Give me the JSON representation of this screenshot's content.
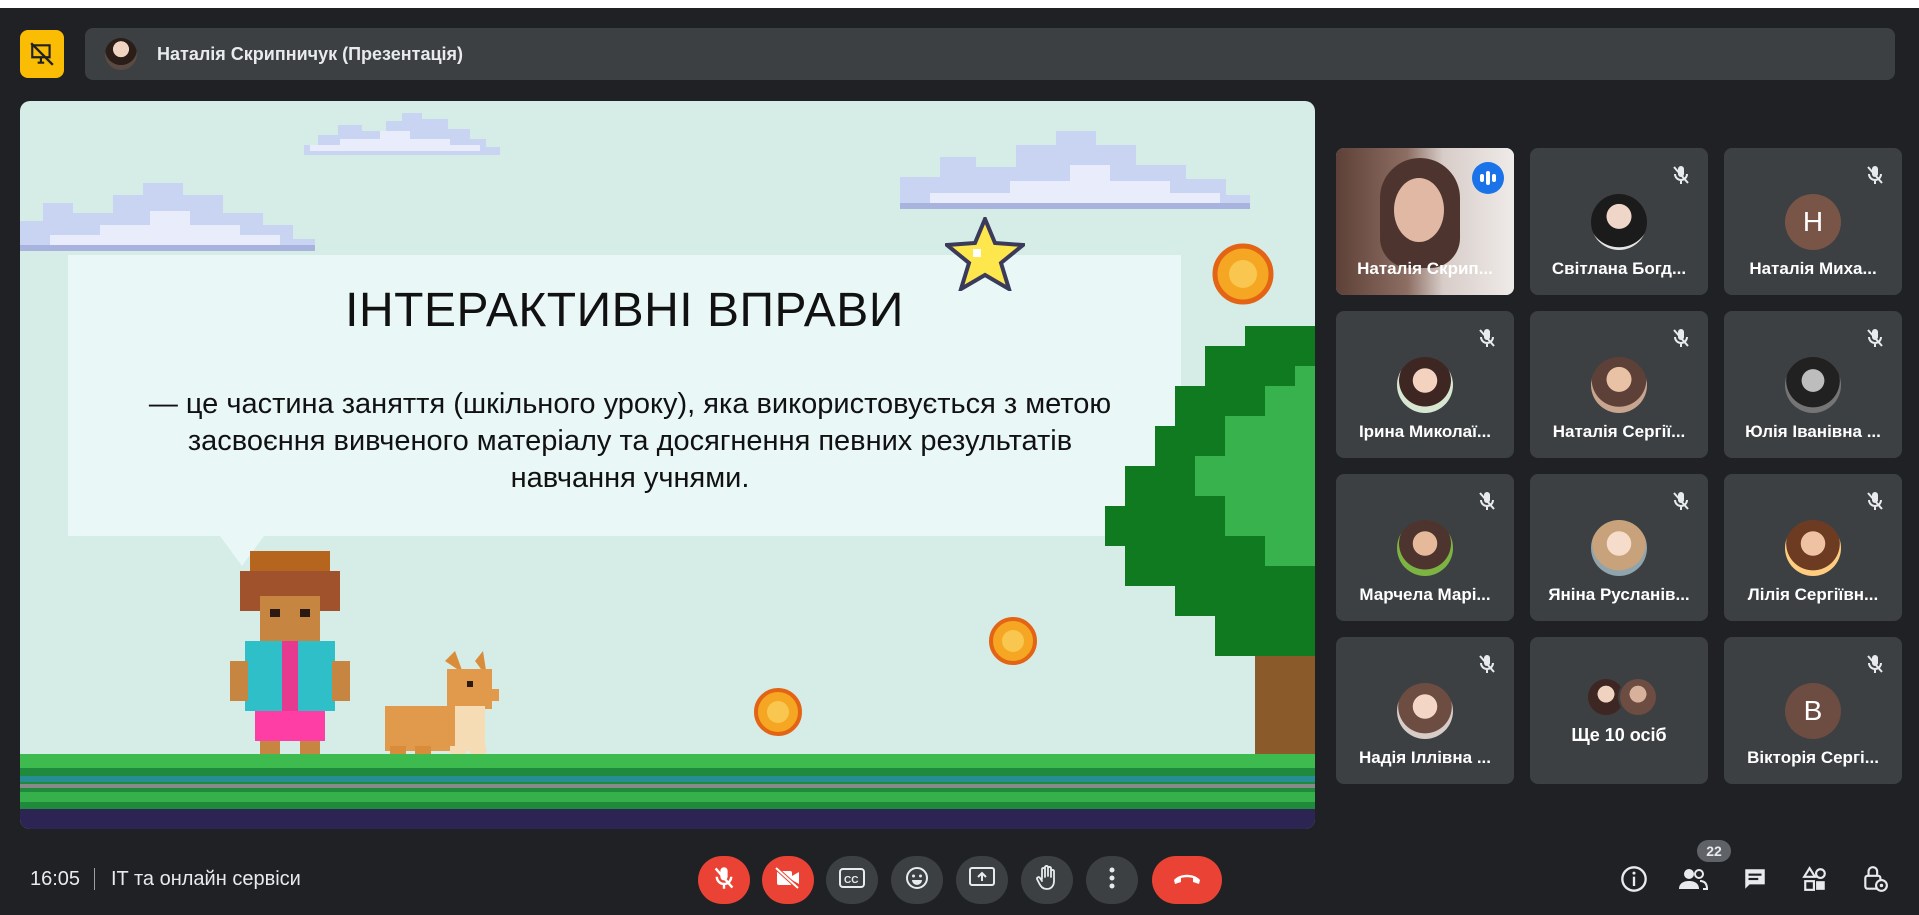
{
  "presenter": {
    "name": "Наталія Скрипничук (Презентація)"
  },
  "slide": {
    "title": "ІНТЕРАКТИВНІ ВПРАВИ",
    "text": "— це частина заняття (шкільного уроку), яка використовується з метою засвоєння вивченого матеріалу та досягнення певних результатів навчання учнями."
  },
  "participants": [
    {
      "name": "Наталія Скрип...",
      "state": "speaking"
    },
    {
      "name": "Світлана Богд...",
      "state": "muted"
    },
    {
      "name": "Наталія Миха...",
      "state": "muted",
      "initial": "Н"
    },
    {
      "name": "Ірина Миколаї...",
      "state": "muted"
    },
    {
      "name": "Наталія Сергії...",
      "state": "muted"
    },
    {
      "name": "Юлія Іванівна ...",
      "state": "muted"
    },
    {
      "name": "Марчела Марі...",
      "state": "muted"
    },
    {
      "name": "Яніна Русланів...",
      "state": "muted"
    },
    {
      "name": "Лілія Сергіївн...",
      "state": "muted"
    },
    {
      "name": "Надія Іллівна ...",
      "state": "muted"
    },
    {
      "name": "Ще 10 осіб",
      "state": "more"
    },
    {
      "name": "Вікторія Сергі...",
      "state": "muted",
      "initial": "В"
    }
  ],
  "footer": {
    "time": "16:05",
    "meeting": "IT та онлайн сервіси",
    "people_count": "22"
  },
  "colors": {
    "background": "#202124",
    "tile": "#3c4043",
    "accent": "#8ab4f8",
    "danger": "#ea4335",
    "present_badge": "#fbbc04"
  },
  "icons": [
    "presentation-off-icon",
    "mic-off-icon",
    "camera-off-icon",
    "captions-icon",
    "emoji-icon",
    "present-screen-icon",
    "raise-hand-icon",
    "more-vert-icon",
    "call-end-icon",
    "info-icon",
    "people-icon",
    "chat-icon",
    "activities-icon",
    "host-controls-icon"
  ]
}
